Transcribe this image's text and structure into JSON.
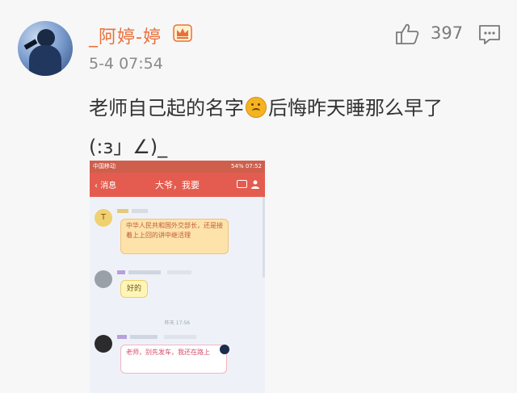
{
  "comment": {
    "username": "_阿婷-婷",
    "timestamp": "5-4 07:54",
    "likes": "397",
    "text_before_emoji": "老师自己起的名字",
    "text_after_emoji": "后悔昨天睡那么早了",
    "text_line2": "(:з」∠)_"
  },
  "screenshot": {
    "status_left": "中国移动",
    "status_right": "54% 07:52",
    "nav_back": "消息",
    "nav_title": "大爷，我要",
    "msg1": "中华人民共和国外交部长，还是接着上上回的讲中继活理",
    "msg2": "好的",
    "time_divider": "昨天 17:56",
    "msg3": "老师，别先发车，我还在路上"
  },
  "colors": {
    "username": "#e8703c",
    "navbar": "#e45c4f"
  }
}
